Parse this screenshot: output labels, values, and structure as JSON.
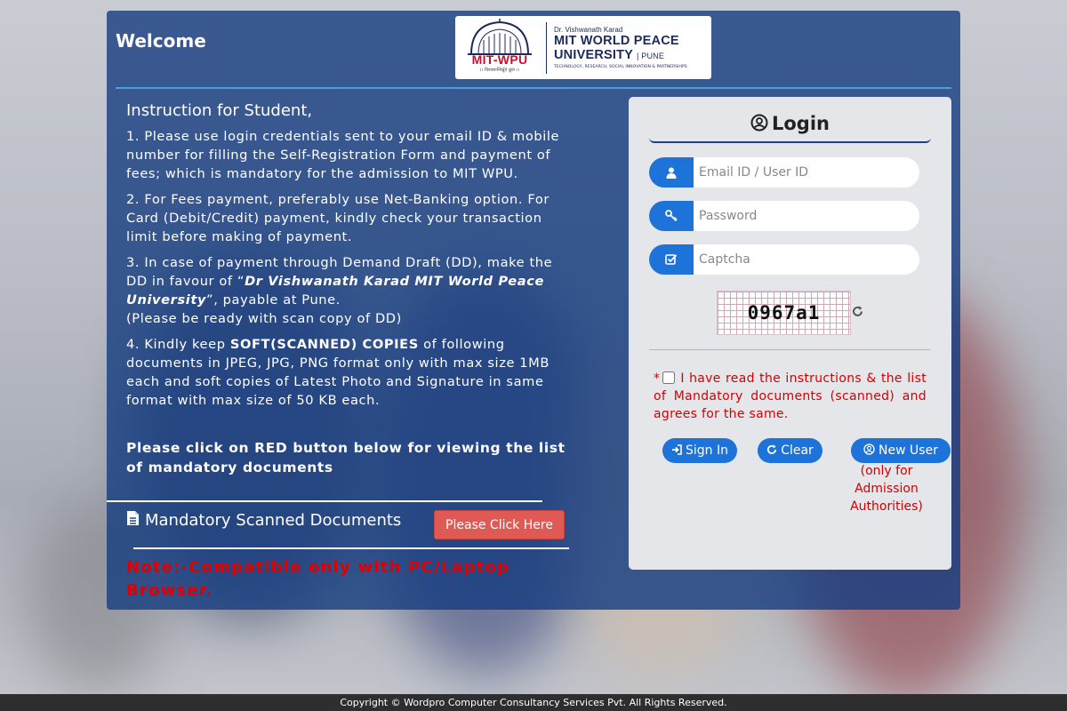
{
  "header": {
    "welcome": "Welcome",
    "logo": {
      "brand": "MIT-WPU",
      "tagline_small": "।। विश्वशान्तिर्ध्रुवं ध्रुवा ।।",
      "line1": "Dr. Vishwanath Karad",
      "line2": "MIT WORLD PEACE",
      "line3": "UNIVERSITY",
      "line3_suffix": "| PUNE",
      "line4": "TECHNOLOGY, RESEARCH, SOCIAL INNOVATION & PARTNERSHIPS"
    }
  },
  "instructions": {
    "heading": "Instruction for Student,",
    "item1": "1. Please use login credentials sent to your email ID & mobile number for filling the Self-Registration Form and payment of fees; which is mandatory for the admission to MIT WPU.",
    "item2": "2. For Fees payment, preferably use Net-Banking option. For Card (Debit/Credit) payment, kindly check your transaction limit before making of payment.",
    "item3_pre": "3. In case of payment through Demand Draft (DD), make the DD in favour of “",
    "item3_name": "Dr Vishwanath Karad MIT World Peace University",
    "item3_post": "”, payable at Pune.",
    "item3_note": "(Please be ready with scan copy of DD)",
    "item4_pre": "4. Kindly keep ",
    "item4_bold": "SOFT(SCANNED) COPIES",
    "item4_post": " of following documents in JPEG, JPG, PNG format only with max size 1MB each and soft copies of Latest Photo and Signature in same format with max size of 50 KB each.",
    "click_note": "Please click on RED button below for viewing the list of mandatory documents",
    "docs_label": "Mandatory Scanned Documents",
    "docs_button": "Please Click Here",
    "compat_note": "Note:-Compatible only with PC/Laptop Browser."
  },
  "login": {
    "title": "Login",
    "email_placeholder": "Email ID / User ID",
    "password_placeholder": "Password",
    "captcha_placeholder": "Captcha",
    "captcha_text": "0967a1",
    "agree_star": "*",
    "agree_text": "I have read the instructions & the list of Mandatory documents (scanned) and agrees for the same.",
    "signin_label": "Sign In",
    "clear_label": "Clear",
    "newuser_label": "New User",
    "newuser_note": "(only for Admission Authorities)"
  },
  "footer": {
    "copyright": "Copyright © Wordpro Computer Consultancy Services Pvt. All Rights Reserved."
  },
  "colors": {
    "panel": "#153c80",
    "accent": "#1e73d8",
    "alert_red": "#e00000",
    "docs_button": "#e05a55"
  },
  "icons": [
    "user-circle-icon",
    "user-icon",
    "key-icon",
    "check-square-icon",
    "refresh-icon",
    "file-icon",
    "sign-in-icon"
  ]
}
